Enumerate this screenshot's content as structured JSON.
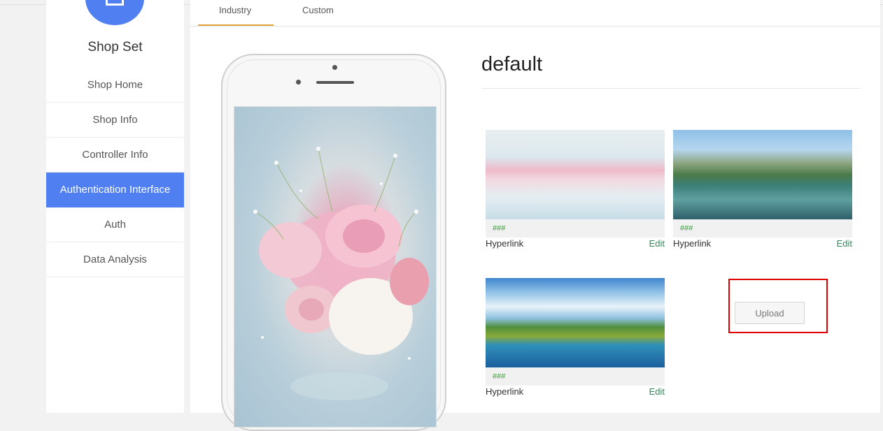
{
  "sidebar": {
    "title": "Shop Set",
    "items": [
      {
        "label": "Shop Home",
        "active": false
      },
      {
        "label": "Shop Info",
        "active": false
      },
      {
        "label": "Controller Info",
        "active": false
      },
      {
        "label": "Authentication Interface",
        "active": true
      },
      {
        "label": "Auth",
        "active": false
      },
      {
        "label": "Data Analysis",
        "active": false
      }
    ]
  },
  "tabs": [
    {
      "label": "Industry",
      "selected": true
    },
    {
      "label": "Custom",
      "selected": false
    }
  ],
  "main": {
    "heading": "default",
    "cards": [
      {
        "tag": "###",
        "link": "Hyperlink",
        "edit": "Edit",
        "image": "pink-flowers"
      },
      {
        "tag": "###",
        "link": "Hyperlink",
        "edit": "Edit",
        "image": "mountain-lake"
      },
      {
        "tag": "###",
        "link": "Hyperlink",
        "edit": "Edit",
        "image": "island-sea"
      }
    ],
    "upload_label": "Upload"
  },
  "colors": {
    "accent": "#4f7ff0",
    "tab_underline": "#e0a33a",
    "edit_link": "#2e8b57",
    "highlight_box": "#e00000"
  }
}
